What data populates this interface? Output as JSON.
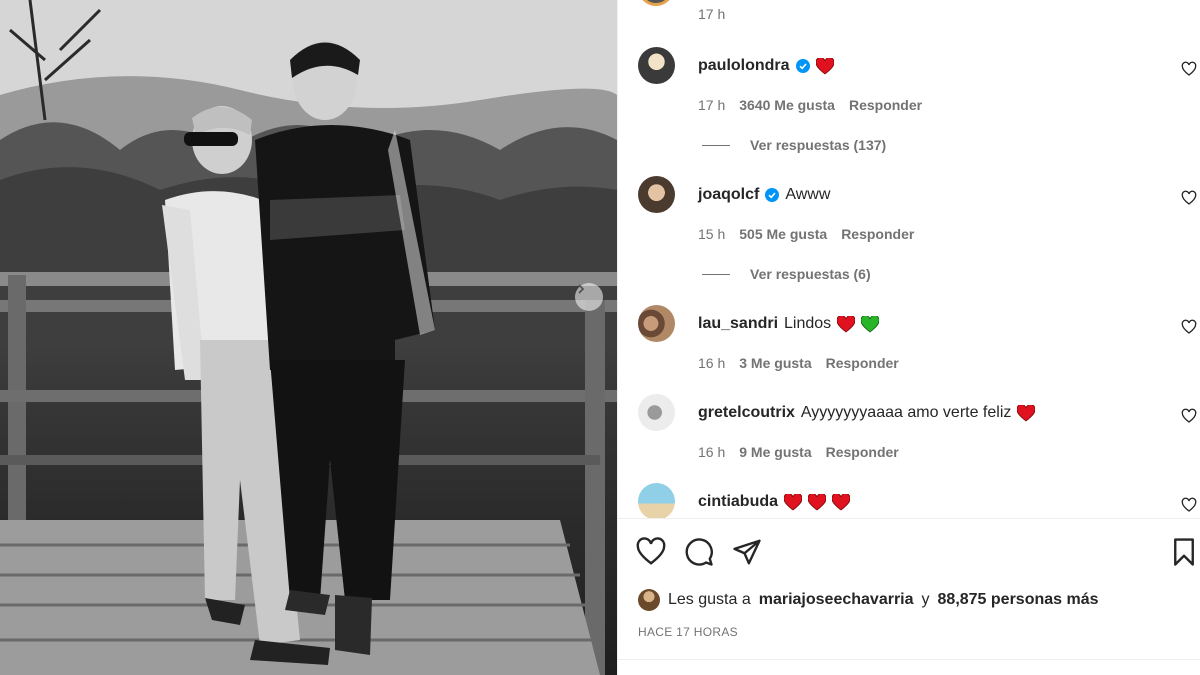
{
  "post": {
    "previous_time": "17 h",
    "image_alt": "Fotografía en blanco y negro de una pareja posando en un mirador de madera"
  },
  "comments": [
    {
      "user": "paulolondra",
      "verified": true,
      "text": "",
      "emojis": [
        "red-heart"
      ],
      "time": "17 h",
      "likes": "3640 Me gusta",
      "reply": "Responder",
      "view_replies": "Ver respuestas (137)"
    },
    {
      "user": "joaqolcf",
      "verified": true,
      "text": "Awww",
      "emojis": [],
      "time": "15 h",
      "likes": "505 Me gusta",
      "reply": "Responder",
      "view_replies": "Ver respuestas (6)"
    },
    {
      "user": "lau_sandri",
      "verified": false,
      "text": "Lindos",
      "emojis": [
        "red-heart",
        "green-heart"
      ],
      "time": "16 h",
      "likes": "3 Me gusta",
      "reply": "Responder",
      "view_replies": ""
    },
    {
      "user": "gretelcoutrix",
      "verified": false,
      "text": "Ayyyyyyyaaaa amo verte feliz",
      "emojis": [
        "red-heart"
      ],
      "time": "16 h",
      "likes": "9 Me gusta",
      "reply": "Responder",
      "view_replies": ""
    },
    {
      "user": "cintiabuda",
      "verified": false,
      "text": "",
      "emojis": [
        "red-heart",
        "red-heart",
        "red-heart"
      ],
      "time": "",
      "likes": "",
      "reply": "",
      "view_replies": ""
    }
  ],
  "actions": {
    "icons": [
      "heart-icon",
      "comment-icon",
      "share-icon",
      "bookmark-icon"
    ]
  },
  "likes": {
    "prefix": "Les gusta a",
    "user": "mariajoseechavarria",
    "connector": "y",
    "others": "88,875 personas más"
  },
  "timestamp": "HACE 17 HORAS",
  "colors": {
    "text": "#262626",
    "secondary": "#737373",
    "verified": "#0095f6",
    "red_heart": "#e0121f",
    "green_heart": "#28b528"
  }
}
